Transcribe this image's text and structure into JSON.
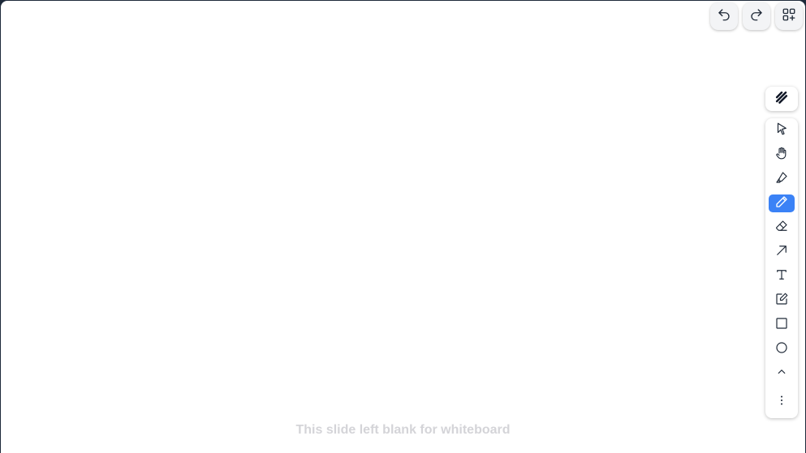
{
  "canvas": {
    "footer_text": "This slide left blank for whiteboard"
  },
  "top_bar": {
    "buttons": [
      {
        "name": "undo-button",
        "icon": "undo-icon"
      },
      {
        "name": "redo-button",
        "icon": "redo-icon"
      },
      {
        "name": "more-shapes-button",
        "icon": "grid-plus-icon"
      }
    ]
  },
  "toolbar": {
    "pen_style_icon": "scribble-icon",
    "active_tool": "pencil",
    "active_color": "#3b82f6",
    "tools": [
      {
        "name": "select",
        "icon": "cursor-icon"
      },
      {
        "name": "hand",
        "icon": "hand-icon"
      },
      {
        "name": "highlighter",
        "icon": "highlighter-icon"
      },
      {
        "name": "pencil",
        "icon": "pencil-icon"
      },
      {
        "name": "eraser",
        "icon": "eraser-icon"
      },
      {
        "name": "arrow",
        "icon": "arrow-icon"
      },
      {
        "name": "text",
        "icon": "text-icon"
      },
      {
        "name": "note",
        "icon": "note-icon"
      },
      {
        "name": "rectangle",
        "icon": "square-icon"
      },
      {
        "name": "ellipse",
        "icon": "circle-icon"
      },
      {
        "name": "collapse",
        "icon": "chevron-up-icon"
      },
      {
        "name": "more",
        "icon": "more-vertical-icon"
      }
    ]
  }
}
